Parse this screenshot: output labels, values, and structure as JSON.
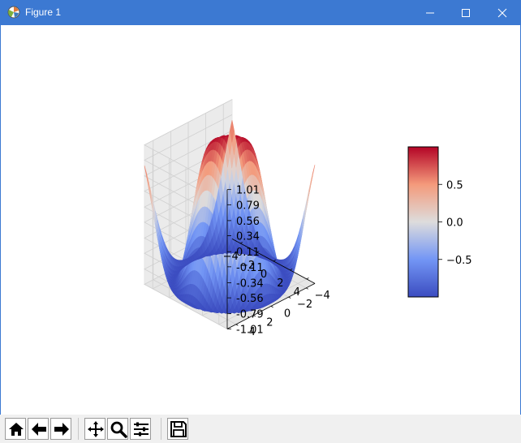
{
  "window": {
    "title": "Figure 1",
    "title_bar_color": "#3c79d2"
  },
  "chart_data": {
    "type": "surface3d",
    "function": "z = sin(sqrt(x^2 + y^2))",
    "colormap": "coolwarm",
    "x_ticks": [
      "−4",
      "−2",
      "0",
      "2",
      "4"
    ],
    "y_ticks": [
      "−4",
      "−2",
      "0",
      "2",
      "4"
    ],
    "z_ticks": [
      "1.01",
      "0.79",
      "0.56",
      "0.34",
      "0.11",
      "-0.11",
      "-0.34",
      "-0.56",
      "-0.79",
      "-1.01"
    ],
    "xlim": [
      -5,
      5
    ],
    "ylim": [
      -5,
      5
    ],
    "zlim": [
      -1.01,
      1.01
    ],
    "colorbar_ticks": [
      "0.5",
      "0.0",
      "−0.5"
    ],
    "colorbar_range": [
      -1,
      1
    ]
  },
  "toolbar": {
    "buttons": [
      {
        "name": "home-icon"
      },
      {
        "name": "back-arrow-icon"
      },
      {
        "name": "forward-arrow-icon"
      },
      {
        "name": "pan-move-icon"
      },
      {
        "name": "zoom-magnifier-icon"
      },
      {
        "name": "configure-subplots-icon"
      },
      {
        "name": "save-floppy-icon"
      }
    ]
  }
}
